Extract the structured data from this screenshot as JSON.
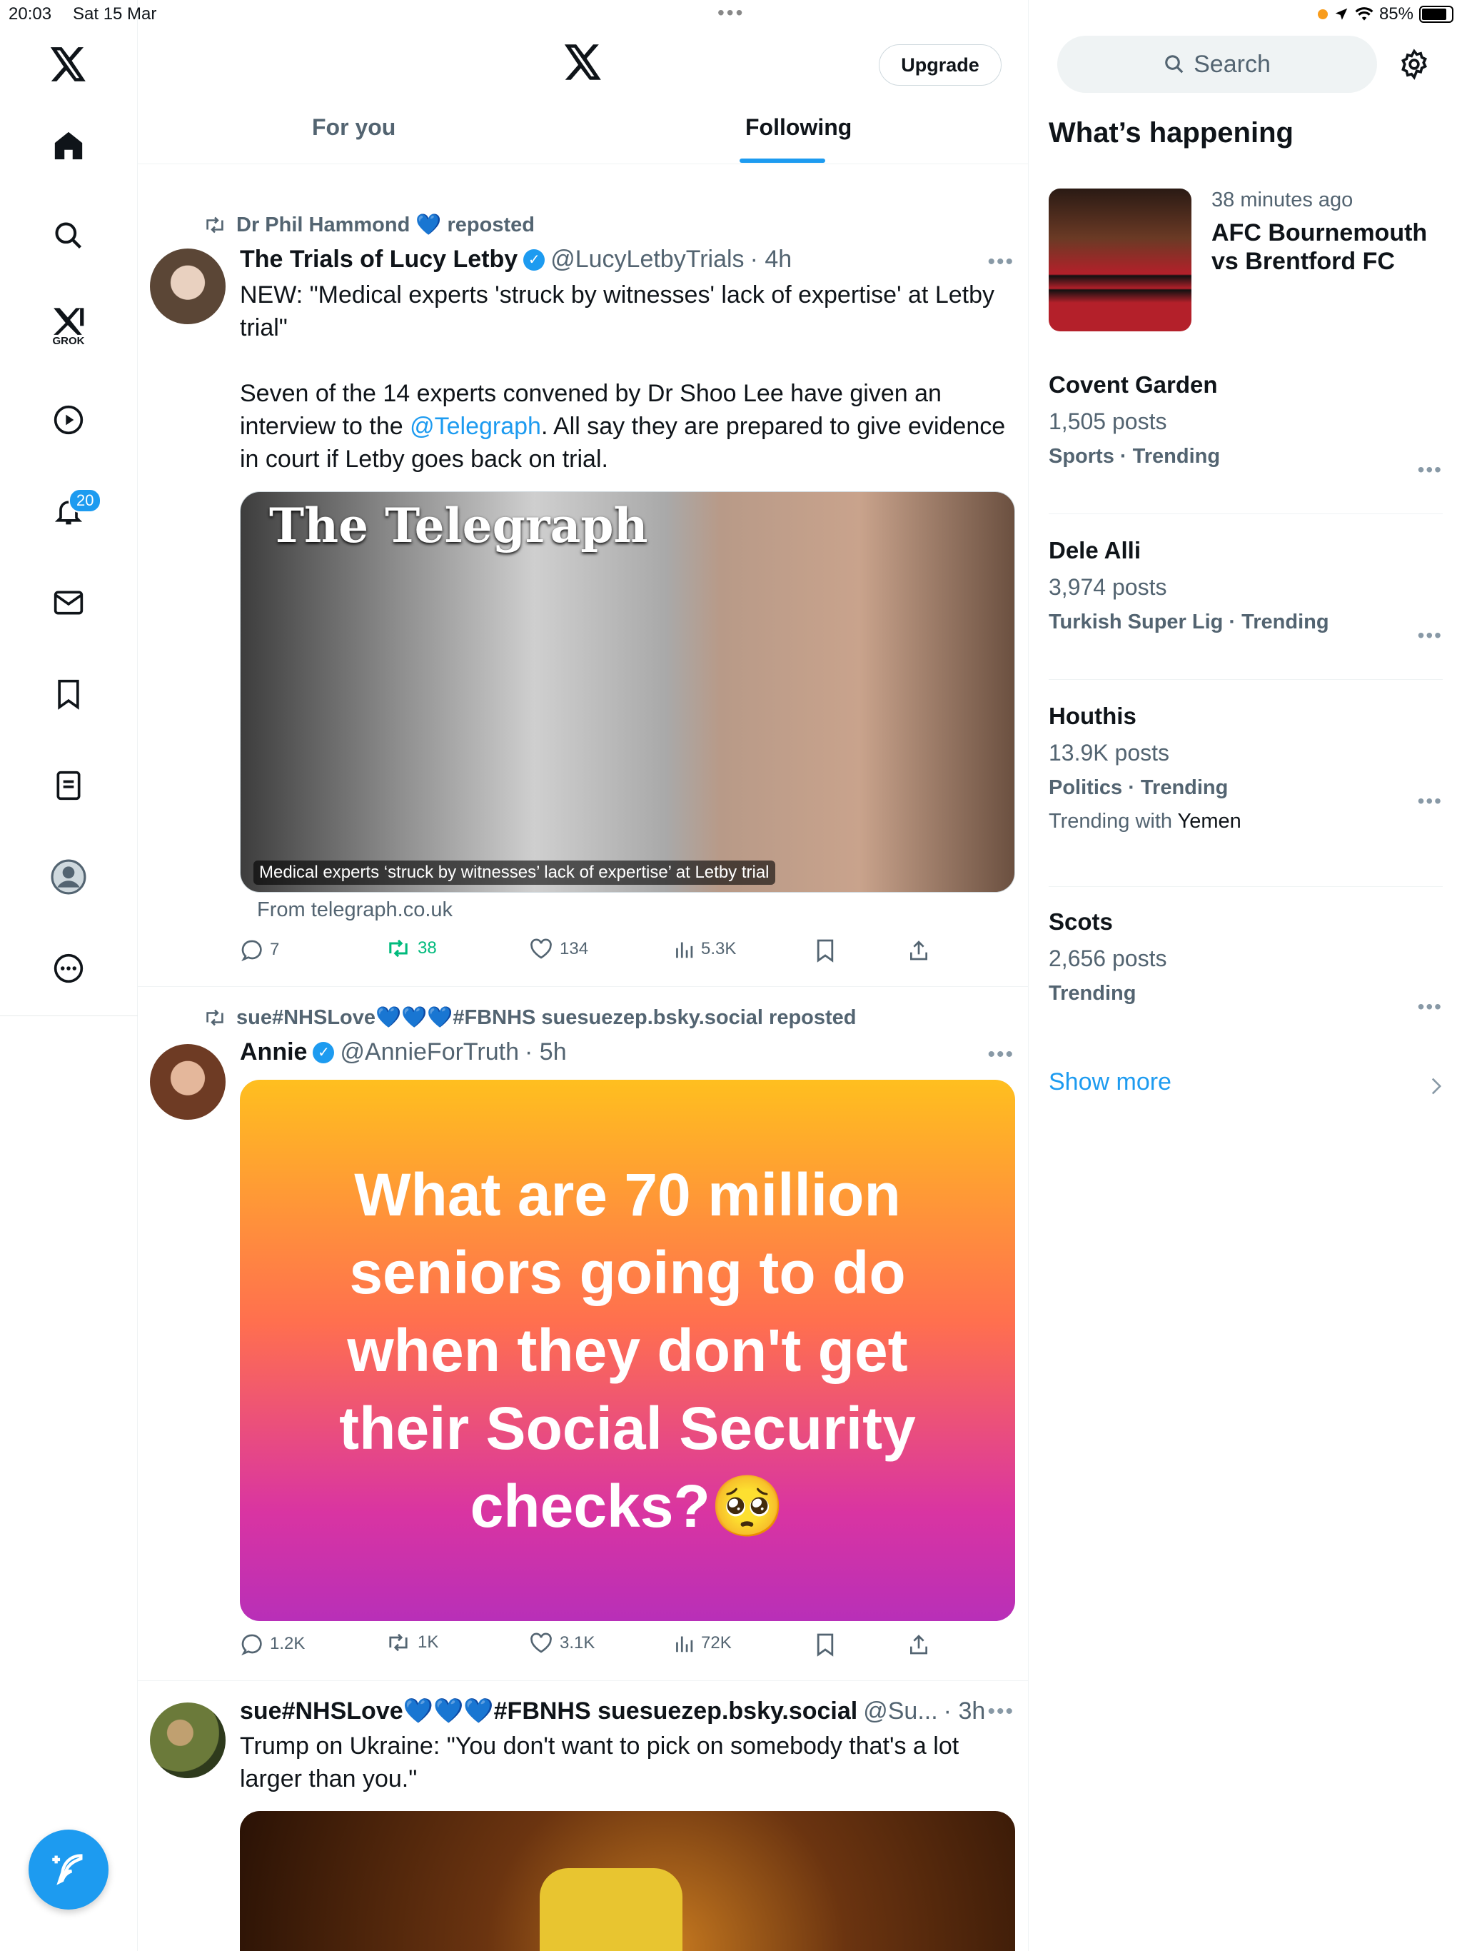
{
  "status_bar": {
    "time": "20:03",
    "date": "Sat 15 Mar",
    "battery": "85%"
  },
  "nav": {
    "notifications_badge": "20",
    "grok_label": "GROK"
  },
  "header": {
    "upgrade_label": "Upgrade",
    "tabs": [
      {
        "label": "For you"
      },
      {
        "label": "Following"
      }
    ],
    "active_tab": "Following"
  },
  "tweets": [
    {
      "reposted_by": "Dr Phil Hammond 💙 reposted",
      "display_name": "The Trials of Lucy Letby",
      "handle": "@LucyLetbyTrials",
      "time": "· 4h",
      "text_1": "NEW: \"Medical experts 'struck by witnesses' lack of expertise' at Letby trial\"",
      "text_2a": "Seven of the 14 experts convened by Dr Shoo Lee have given an interview to the ",
      "mention": "@Telegraph",
      "text_2b": ". All say they are prepared to give evidence in court if Letby goes back on trial.",
      "media_title": "The Telegraph",
      "media_caption": "Medical experts ‘struck by witnesses’ lack of expertise’ at Letby trial",
      "link_source": "From telegraph.co.uk",
      "replies": "7",
      "reposts": "38",
      "likes": "134",
      "views": "5.3K"
    },
    {
      "reposted_by": "sue#NHSLove💙💙💙#FBNHS suesuezep.bsky.social reposted",
      "display_name": "Annie",
      "handle": "@AnnieForTruth",
      "time": "· 5h",
      "media_text_lines": [
        "What are 70 million",
        "seniors going to do",
        "when they don't get",
        "their Social Security",
        "checks?🥺"
      ],
      "replies": "1.2K",
      "reposts": "1K",
      "likes": "3.1K",
      "views": "72K"
    },
    {
      "display_name": "sue#NHSLove💙💙💙#FBNHS suesuezep.bsky.social",
      "handle": "@Su...",
      "time": "· 3h",
      "text": "Trump on Ukraine: \"You don't want to pick on somebody that's a lot larger than you.\""
    }
  ],
  "sidebar": {
    "search_placeholder": "Search",
    "whats_happening": "What’s happening",
    "featured": {
      "time": "38 minutes ago",
      "title_line1": "AFC Bournemouth",
      "title_line2": "vs Brentford FC"
    },
    "trends": [
      {
        "name": "Covent Garden",
        "posts": "1,505 posts",
        "context": "Sports · Trending"
      },
      {
        "name": "Dele Alli",
        "posts": "3,974 posts",
        "context": "Turkish Super Lig · Trending"
      },
      {
        "name": "Houthis",
        "posts": "13.9K posts",
        "context": "Politics · Trending",
        "extra_prefix": "Trending with ",
        "extra_name": "Yemen"
      },
      {
        "name": "Scots",
        "posts": "2,656 posts",
        "context": "Trending"
      }
    ],
    "show_more": "Show more"
  }
}
